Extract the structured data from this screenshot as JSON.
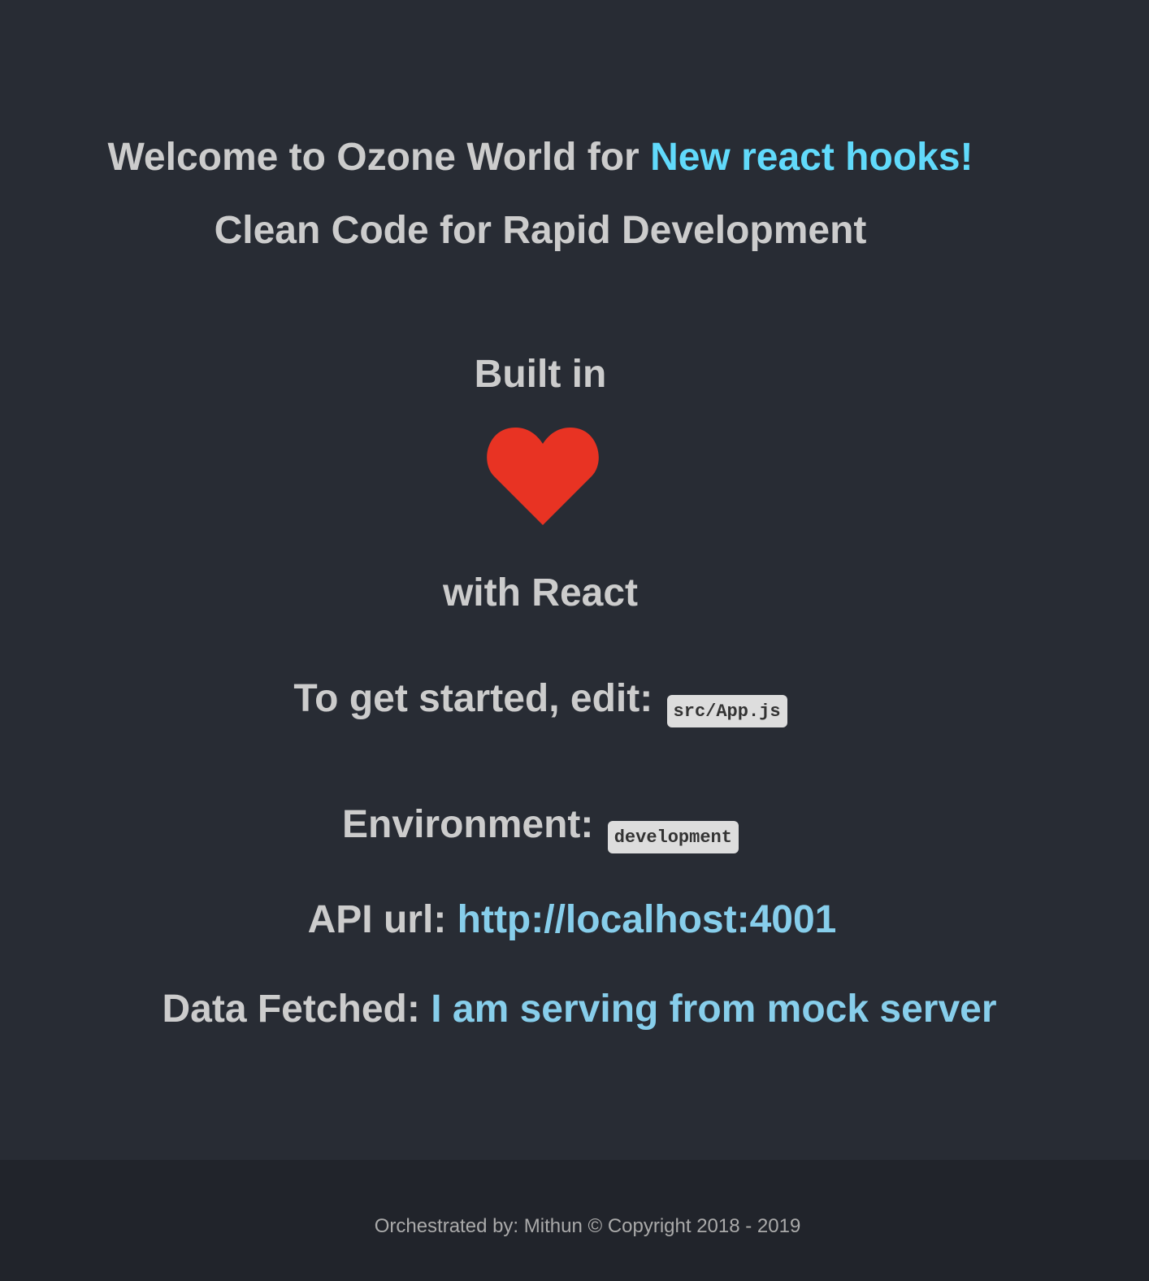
{
  "header": {
    "welcome_prefix": "Welcome to Ozone World for ",
    "welcome_highlight": "New react hooks!",
    "subtitle": "Clean Code for Rapid Development"
  },
  "built": {
    "prefix": "Built in",
    "icon": "heart-icon",
    "suffix": "with React"
  },
  "get_started": {
    "label": "To get started, edit: ",
    "file": "src/App.js"
  },
  "environment": {
    "label": "Environment: ",
    "value": "development"
  },
  "api": {
    "label": "API url: ",
    "url": "http://localhost:4001"
  },
  "data_fetched": {
    "label": "Data Fetched: ",
    "value": "I am serving from mock server"
  },
  "footer": {
    "text": "Orchestrated by: Mithun © Copyright 2018 - 2019"
  },
  "colors": {
    "background": "#282c34",
    "footer_background": "#21242b",
    "text": "#cccccc",
    "accent": "#61dafb",
    "link": "#87ceeb",
    "heart": "#e83323"
  }
}
